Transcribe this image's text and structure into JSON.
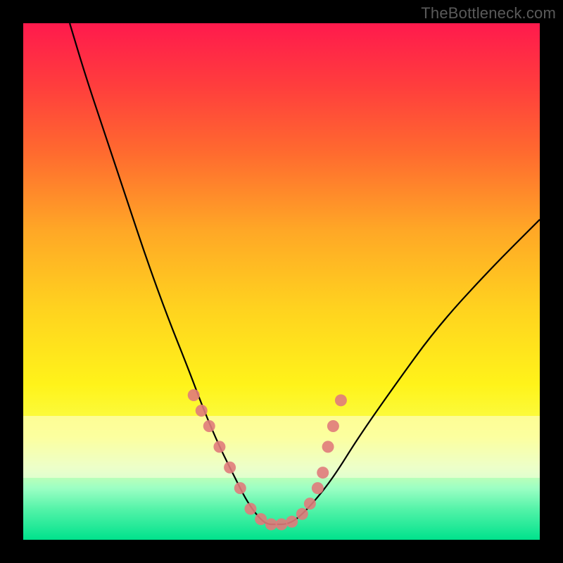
{
  "watermark": "TheBottleneck.com",
  "chart_data": {
    "type": "line",
    "title": "",
    "xlabel": "",
    "ylabel": "",
    "xlim": [
      0,
      100
    ],
    "ylim": [
      0,
      100
    ],
    "grid": false,
    "legend": false,
    "background_gradient": {
      "stops": [
        {
          "pos": 0,
          "color": "#ff1a4d"
        },
        {
          "pos": 12,
          "color": "#ff3d3d"
        },
        {
          "pos": 25,
          "color": "#ff6a2f"
        },
        {
          "pos": 40,
          "color": "#ffa726"
        },
        {
          "pos": 55,
          "color": "#ffd21f"
        },
        {
          "pos": 70,
          "color": "#fff31a"
        },
        {
          "pos": 80,
          "color": "#f9ff4f"
        },
        {
          "pos": 86,
          "color": "#d6ffad"
        },
        {
          "pos": 90,
          "color": "#9cffc4"
        },
        {
          "pos": 94,
          "color": "#55f3a9"
        },
        {
          "pos": 100,
          "color": "#00e28c"
        }
      ]
    },
    "pale_band": {
      "y_from": 75,
      "y_to": 88
    },
    "series": [
      {
        "name": "bottleneck-curve",
        "color": "#000000",
        "x": [
          9,
          12,
          16,
          20,
          24,
          28,
          32,
          35,
          38,
          41,
          43,
          45,
          47,
          49,
          51,
          53,
          56,
          60,
          65,
          72,
          80,
          90,
          100
        ],
        "values": [
          100,
          90,
          78,
          66,
          54,
          43,
          33,
          25,
          18,
          12,
          8,
          5,
          3,
          3,
          3,
          4,
          7,
          12,
          20,
          30,
          41,
          52,
          62
        ]
      }
    ],
    "markers": {
      "name": "highlighted-points",
      "color": "#e07b7b",
      "x": [
        33,
        34.5,
        36,
        38,
        40,
        42,
        44,
        46,
        48,
        50,
        52,
        54,
        55.5,
        57,
        58,
        59,
        60,
        61.5
      ],
      "values": [
        28,
        25,
        22,
        18,
        14,
        10,
        6,
        4,
        3,
        3,
        3.5,
        5,
        7,
        10,
        13,
        18,
        22,
        27
      ]
    }
  }
}
